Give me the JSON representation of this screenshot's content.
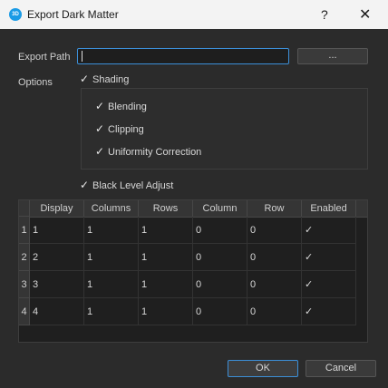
{
  "window": {
    "title": "Export Dark Matter",
    "icon_text": "3D",
    "help": "?",
    "close": "✕"
  },
  "export_path": {
    "label": "Export Path",
    "value": "",
    "browse_label": "..."
  },
  "options": {
    "label": "Options",
    "shading": {
      "label": "Shading",
      "checked": true
    },
    "sub": [
      {
        "label": "Blending",
        "checked": true
      },
      {
        "label": "Clipping",
        "checked": true
      },
      {
        "label": "Uniformity Correction",
        "checked": true
      }
    ],
    "black_level": {
      "label": "Black Level Adjust",
      "checked": true
    }
  },
  "table": {
    "columns": [
      "Display",
      "Columns",
      "Rows",
      "Column",
      "Row",
      "Enabled"
    ],
    "rows": [
      {
        "num": "1",
        "cells": [
          "1",
          "1",
          "1",
          "0",
          "0"
        ],
        "enabled": "✓"
      },
      {
        "num": "2",
        "cells": [
          "2",
          "1",
          "1",
          "0",
          "0"
        ],
        "enabled": "✓"
      },
      {
        "num": "3",
        "cells": [
          "3",
          "1",
          "1",
          "0",
          "0"
        ],
        "enabled": "✓"
      },
      {
        "num": "4",
        "cells": [
          "4",
          "1",
          "1",
          "0",
          "0"
        ],
        "enabled": "✓"
      }
    ]
  },
  "buttons": {
    "ok": "OK",
    "cancel": "Cancel"
  }
}
